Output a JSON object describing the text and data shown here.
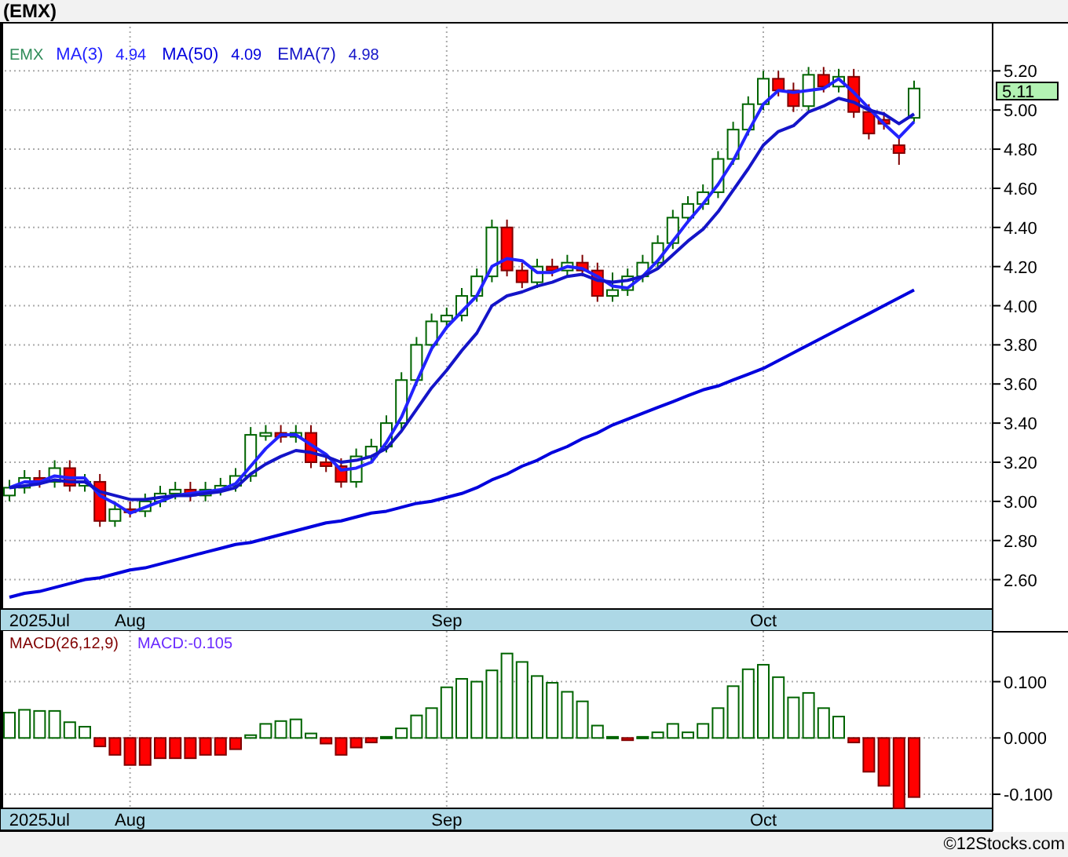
{
  "title": "(EMX)",
  "price_panel": {
    "symbol": "EMX",
    "legend_values": [
      "4.94",
      "4.09",
      "4.98"
    ],
    "last_price": "5.11",
    "chart_data": {
      "type": "candlestick",
      "grid": true,
      "ylim": [
        2.45,
        5.45
      ],
      "categories": [
        null,
        null,
        "2025Jul",
        null,
        null,
        null,
        null,
        null,
        "Aug",
        null,
        null,
        null,
        null,
        null,
        null,
        null,
        null,
        null,
        null,
        null,
        null,
        null,
        null,
        null,
        null,
        null,
        null,
        null,
        null,
        "Sep",
        null,
        null,
        null,
        null,
        null,
        null,
        null,
        null,
        null,
        null,
        null,
        null,
        null,
        null,
        null,
        null,
        null,
        null,
        null,
        null,
        "Oct",
        null,
        null,
        null,
        null,
        null,
        null,
        null,
        null,
        null,
        null
      ],
      "yticks": [
        {
          "value": 2.6,
          "label": "2.60"
        },
        {
          "value": 2.8,
          "label": "2.80"
        },
        {
          "value": 3.0,
          "label": "3.00"
        },
        {
          "value": 3.2,
          "label": "3.20"
        },
        {
          "value": 3.4,
          "label": "3.40"
        },
        {
          "value": 3.6,
          "label": "3.60"
        },
        {
          "value": 3.8,
          "label": "3.80"
        },
        {
          "value": 4.0,
          "label": "4.00"
        },
        {
          "value": 4.2,
          "label": "4.20"
        },
        {
          "value": 4.4,
          "label": "4.40"
        },
        {
          "value": 4.6,
          "label": "4.60"
        },
        {
          "value": 4.8,
          "label": "4.80"
        },
        {
          "value": 5.0,
          "label": "5.00"
        },
        {
          "value": 5.2,
          "label": "5.20"
        }
      ],
      "ohlc": [
        [
          3.03,
          3.11,
          3.0,
          3.07
        ],
        [
          3.07,
          3.16,
          3.04,
          3.12
        ],
        [
          3.12,
          3.16,
          3.07,
          3.1
        ],
        [
          3.1,
          3.21,
          3.07,
          3.17
        ],
        [
          3.17,
          3.21,
          3.05,
          3.08
        ],
        [
          3.08,
          3.14,
          3.05,
          3.1
        ],
        [
          3.1,
          3.14,
          2.87,
          2.9
        ],
        [
          2.9,
          3.0,
          2.87,
          2.96
        ],
        [
          2.96,
          3.0,
          2.92,
          2.95
        ],
        [
          2.95,
          3.04,
          2.92,
          3.0
        ],
        [
          3.0,
          3.08,
          2.97,
          3.04
        ],
        [
          3.04,
          3.1,
          3.01,
          3.06
        ],
        [
          3.06,
          3.1,
          3.0,
          3.03
        ],
        [
          3.03,
          3.1,
          3.0,
          3.06
        ],
        [
          3.06,
          3.12,
          3.03,
          3.08
        ],
        [
          3.08,
          3.17,
          3.05,
          3.13
        ],
        [
          3.13,
          3.38,
          3.1,
          3.34
        ],
        [
          3.34,
          3.39,
          3.31,
          3.35
        ],
        [
          3.35,
          3.39,
          3.3,
          3.33
        ],
        [
          3.33,
          3.39,
          3.3,
          3.35
        ],
        [
          3.35,
          3.39,
          3.17,
          3.2
        ],
        [
          3.2,
          3.24,
          3.15,
          3.18
        ],
        [
          3.18,
          3.22,
          3.07,
          3.1
        ],
        [
          3.1,
          3.27,
          3.07,
          3.23
        ],
        [
          3.23,
          3.32,
          3.2,
          3.28
        ],
        [
          3.28,
          3.44,
          3.25,
          3.4
        ],
        [
          3.4,
          3.66,
          3.37,
          3.62
        ],
        [
          3.62,
          3.84,
          3.59,
          3.8
        ],
        [
          3.8,
          3.96,
          3.77,
          3.92
        ],
        [
          3.92,
          3.99,
          3.89,
          3.95
        ],
        [
          3.95,
          4.09,
          3.92,
          4.05
        ],
        [
          4.05,
          4.19,
          4.02,
          4.15
        ],
        [
          4.15,
          4.44,
          4.12,
          4.4
        ],
        [
          4.4,
          4.44,
          4.15,
          4.18
        ],
        [
          4.18,
          4.22,
          4.09,
          4.12
        ],
        [
          4.12,
          4.24,
          4.09,
          4.2
        ],
        [
          4.2,
          4.24,
          4.15,
          4.18
        ],
        [
          4.18,
          4.26,
          4.15,
          4.22
        ],
        [
          4.22,
          4.26,
          4.15,
          4.18
        ],
        [
          4.18,
          4.22,
          4.02,
          4.05
        ],
        [
          4.05,
          4.17,
          4.02,
          4.08
        ],
        [
          4.08,
          4.19,
          4.05,
          4.15
        ],
        [
          4.15,
          4.26,
          4.12,
          4.22
        ],
        [
          4.22,
          4.36,
          4.19,
          4.32
        ],
        [
          4.32,
          4.49,
          4.29,
          4.45
        ],
        [
          4.45,
          4.56,
          4.42,
          4.52
        ],
        [
          4.52,
          4.62,
          4.49,
          4.58
        ],
        [
          4.58,
          4.79,
          4.55,
          4.75
        ],
        [
          4.75,
          4.94,
          4.72,
          4.9
        ],
        [
          4.9,
          5.07,
          4.87,
          5.03
        ],
        [
          5.03,
          5.2,
          5.0,
          5.16
        ],
        [
          5.16,
          5.2,
          5.07,
          5.1
        ],
        [
          5.1,
          5.14,
          4.99,
          5.02
        ],
        [
          5.02,
          5.22,
          4.99,
          5.18
        ],
        [
          5.18,
          5.22,
          5.09,
          5.12
        ],
        [
          5.12,
          5.21,
          5.09,
          5.17
        ],
        [
          5.17,
          5.21,
          4.96,
          4.99
        ],
        [
          4.99,
          5.03,
          4.85,
          4.88
        ],
        [
          4.95,
          4.99,
          4.9,
          4.93
        ],
        [
          4.82,
          4.86,
          4.72,
          4.78
        ],
        [
          4.96,
          5.15,
          4.94,
          5.11
        ]
      ],
      "series": [
        {
          "name": "MA(3)",
          "type": "line",
          "color": "#2222ff",
          "values": [
            3.07,
            3.1,
            3.1,
            3.13,
            3.12,
            3.12,
            3.03,
            2.99,
            2.94,
            2.97,
            3.0,
            3.03,
            3.04,
            3.05,
            3.06,
            3.09,
            3.18,
            3.27,
            3.34,
            3.34,
            3.29,
            3.24,
            3.16,
            3.17,
            3.2,
            3.3,
            3.43,
            3.61,
            3.78,
            3.89,
            3.97,
            4.05,
            4.2,
            4.24,
            4.23,
            4.17,
            4.17,
            4.2,
            4.19,
            4.15,
            4.1,
            4.09,
            4.15,
            4.23,
            4.33,
            4.43,
            4.52,
            4.62,
            4.74,
            4.89,
            5.03,
            5.1,
            5.09,
            5.1,
            5.11,
            5.16,
            5.09,
            5.01,
            4.93,
            4.86,
            4.94
          ]
        },
        {
          "name": "MA(50)",
          "type": "line",
          "color": "#0000dd",
          "values": [
            2.51,
            2.53,
            2.54,
            2.56,
            2.58,
            2.6,
            2.61,
            2.63,
            2.65,
            2.66,
            2.68,
            2.7,
            2.72,
            2.74,
            2.76,
            2.78,
            2.79,
            2.81,
            2.83,
            2.85,
            2.87,
            2.89,
            2.9,
            2.92,
            2.94,
            2.95,
            2.97,
            2.99,
            3.0,
            3.02,
            3.04,
            3.07,
            3.11,
            3.14,
            3.18,
            3.21,
            3.25,
            3.28,
            3.32,
            3.35,
            3.39,
            3.42,
            3.45,
            3.48,
            3.51,
            3.54,
            3.57,
            3.59,
            3.62,
            3.65,
            3.68,
            3.72,
            3.76,
            3.8,
            3.84,
            3.88,
            3.92,
            3.96,
            4.0,
            4.04,
            4.08
          ]
        },
        {
          "name": "EMA(7)",
          "type": "line",
          "color": "#1414c8",
          "values": [
            3.07,
            3.08,
            3.09,
            3.11,
            3.1,
            3.1,
            3.05,
            3.03,
            3.01,
            3.01,
            3.02,
            3.03,
            3.03,
            3.04,
            3.05,
            3.07,
            3.14,
            3.19,
            3.23,
            3.26,
            3.25,
            3.23,
            3.2,
            3.21,
            3.23,
            3.27,
            3.36,
            3.47,
            3.58,
            3.67,
            3.77,
            3.86,
            4.0,
            4.05,
            4.07,
            4.1,
            4.12,
            4.15,
            4.16,
            4.13,
            4.12,
            4.13,
            4.15,
            4.19,
            4.26,
            4.33,
            4.39,
            4.48,
            4.59,
            4.7,
            4.82,
            4.89,
            4.92,
            4.99,
            5.02,
            5.06,
            5.04,
            5.0,
            4.98,
            4.93,
            4.98
          ]
        }
      ]
    }
  },
  "macd_panel": {
    "legend": [
      {
        "kind": "name",
        "text": "MACD(26,12,9)"
      },
      {
        "kind": "value",
        "text": "MACD:-0.105"
      }
    ],
    "chart_data": {
      "type": "bar",
      "grid": true,
      "ylim": [
        -0.125,
        0.19
      ],
      "categories": [
        null,
        null,
        "2025Jul",
        null,
        null,
        null,
        null,
        null,
        "Aug",
        null,
        null,
        null,
        null,
        null,
        null,
        null,
        null,
        null,
        null,
        null,
        null,
        null,
        null,
        null,
        null,
        null,
        null,
        null,
        null,
        "Sep",
        null,
        null,
        null,
        null,
        null,
        null,
        null,
        null,
        null,
        null,
        null,
        null,
        null,
        null,
        null,
        null,
        null,
        null,
        null,
        null,
        "Oct",
        null,
        null,
        null,
        null,
        null,
        null,
        null,
        null,
        null,
        null
      ],
      "yticks": [
        {
          "value": 0.1,
          "label": "0.100"
        },
        {
          "value": 0,
          "label": "0.000"
        },
        {
          "value": -0.1,
          "label": "-0.100"
        }
      ],
      "values": [
        0.045,
        0.05,
        0.048,
        0.048,
        0.028,
        0.02,
        -0.015,
        -0.03,
        -0.048,
        -0.048,
        -0.036,
        -0.036,
        -0.036,
        -0.03,
        -0.03,
        -0.02,
        0.005,
        0.025,
        0.03,
        0.033,
        0.008,
        -0.01,
        -0.03,
        -0.017,
        -0.008,
        0.002,
        0.017,
        0.04,
        0.053,
        0.09,
        0.105,
        0.1,
        0.12,
        0.15,
        0.135,
        0.11,
        0.098,
        0.082,
        0.065,
        0.022,
        0.002,
        -0.004,
        0.002,
        0.01,
        0.025,
        0.01,
        0.025,
        0.053,
        0.092,
        0.122,
        0.13,
        0.108,
        0.072,
        0.08,
        0.053,
        0.038,
        -0.008,
        -0.06,
        -0.085,
        -0.125,
        -0.105
      ]
    }
  },
  "footer": "©12Stocks.com"
}
